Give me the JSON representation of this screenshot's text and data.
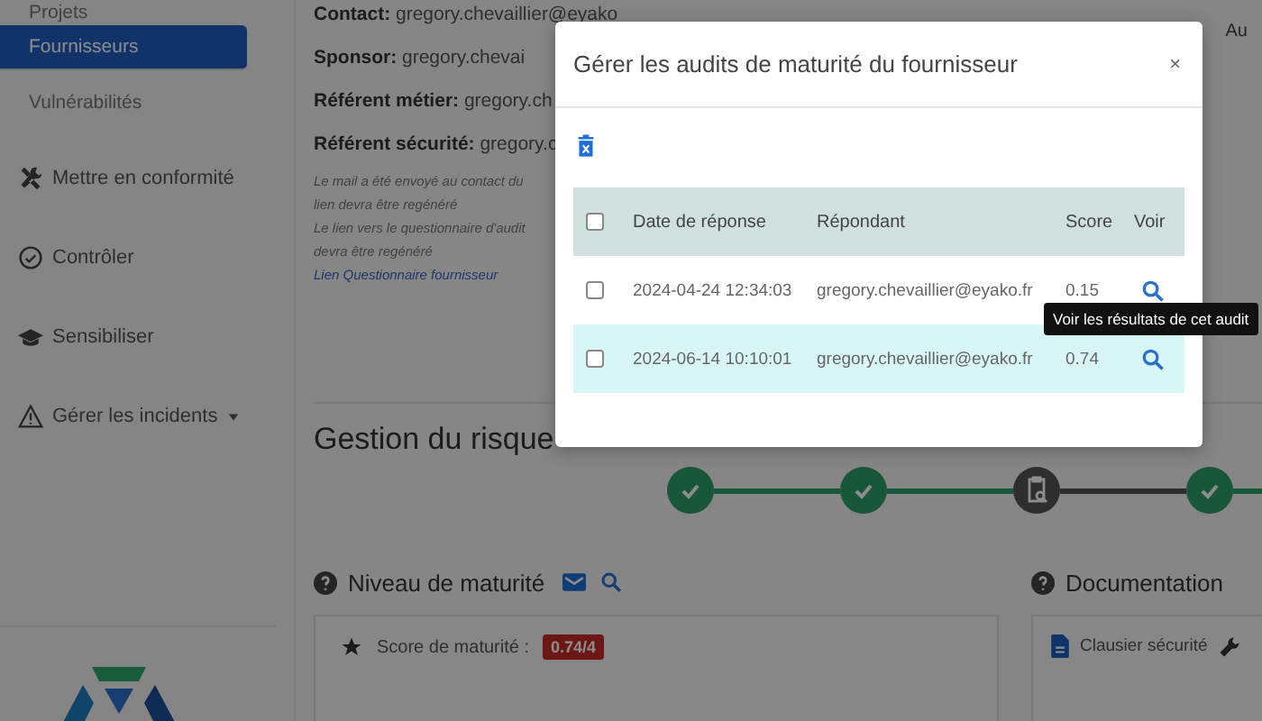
{
  "sidebar": {
    "items": [
      {
        "label": "Projets",
        "kind": "sub",
        "selected": false,
        "dropdown": false
      },
      {
        "label": "Fournisseurs",
        "kind": "sub",
        "selected": true,
        "dropdown": false
      },
      {
        "label": "Vulnérabilités",
        "kind": "sub",
        "selected": false,
        "dropdown": false
      },
      {
        "label": "Mettre en conformité",
        "kind": "tools",
        "selected": false,
        "dropdown": false
      },
      {
        "label": "Contrôler",
        "kind": "check",
        "selected": false,
        "dropdown": false
      },
      {
        "label": "Sensibiliser",
        "kind": "graduation",
        "selected": false,
        "dropdown": false
      },
      {
        "label": "Gérer les incidents",
        "kind": "warning",
        "selected": false,
        "dropdown": true
      }
    ]
  },
  "supplier": {
    "details": [
      {
        "label": "Contact:",
        "value": "gregory.chevaillier@eyako"
      },
      {
        "label": "Sponsor:",
        "value": "gregory.chevai"
      },
      {
        "label": "Référent métier:",
        "value": "gregory.ch"
      },
      {
        "label": "Référent sécurité:",
        "value": "gregory.c"
      }
    ],
    "notes": [
      "Le mail a été envoyé au contact du",
      "lien devra être regénéré",
      "Le lien vers le questionnaire d'audit",
      "devra être regénéré"
    ],
    "link": "Lien Questionnaire fournisseur",
    "right_text": "Au"
  },
  "risk": {
    "title": "Gestion du risque",
    "steps": [
      {
        "kind": "done"
      },
      {
        "kind": "done"
      },
      {
        "kind": "review"
      },
      {
        "kind": "done"
      }
    ]
  },
  "maturity": {
    "title": "Niveau de maturité",
    "score_label": "Score de maturité :",
    "score": "0.74/4"
  },
  "documentation": {
    "title": "Documentation",
    "items": [
      "Clausier sécurité"
    ]
  },
  "modal": {
    "title": "Gérer les audits de maturité du fournisseur",
    "close": "×",
    "columns": [
      "Date de réponse",
      "Répondant",
      "Score",
      "Voir"
    ],
    "header_checked": false,
    "rows": [
      {
        "date": "2024-04-24 12:34:03",
        "respondent": "gregory.chevaillier@eyako.fr",
        "score": "0.15",
        "checked": false,
        "hovered": false
      },
      {
        "date": "2024-06-14 10:10:01",
        "respondent": "gregory.chevaillier@eyako.fr",
        "score": "0.74",
        "checked": false,
        "hovered": true
      }
    ],
    "tooltip": "Voir les résultats de cet audit"
  }
}
